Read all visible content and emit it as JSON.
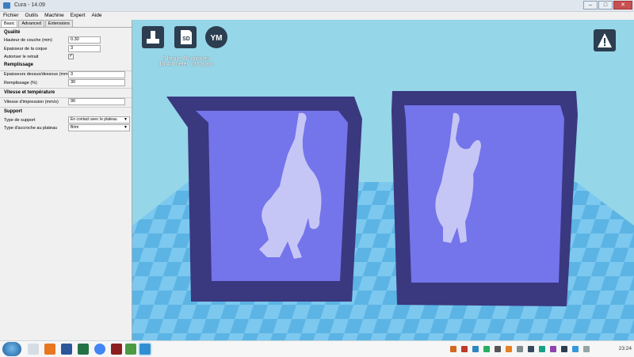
{
  "window": {
    "title": "Cura - 14.09",
    "buttons": {
      "minimize": "–",
      "maximize": "□",
      "close": "✕"
    }
  },
  "menu": [
    "Fichier",
    "Outils",
    "Machine",
    "Expert",
    "Aide"
  ],
  "tabs": [
    "Basic",
    "Advanced",
    "Extensions"
  ],
  "sections": {
    "quality": "Qualité",
    "fill": "Remplissage",
    "speed_temp": "Vitesse et température",
    "support": "Support"
  },
  "settings": {
    "layer_height": {
      "label": "Hauteur de couche (mm)",
      "value": "0.30"
    },
    "shell_thickness": {
      "label": "Epaisseur de la coque",
      "value": "3"
    },
    "retraction": {
      "label": "Autoriser le retrait",
      "value": "✓"
    },
    "bottom_top": {
      "label": "Epaisseurs dessus/dessous (mm)",
      "value": "3"
    },
    "fill_density": {
      "label": "Remplissage (%)",
      "value": "30"
    },
    "print_speed": {
      "label": "Vitesse d'impression (mm/s)",
      "value": "90"
    },
    "support_type": {
      "label": "Type de support",
      "value": "En contact avec le plateau"
    },
    "adhesion": {
      "label": "Type d'accroche au plateau",
      "value": "Brim"
    }
  },
  "toolbar": {
    "load_icon": "load-model-icon",
    "sd_label": "SD",
    "ym_label": "YM",
    "view_icon": "view-mode-icon"
  },
  "print_info": {
    "time": "5 heure 46 minutes",
    "material": "10.40 meter 130 gram"
  },
  "taskbar": {
    "clock": "23:24"
  },
  "colors": {
    "sky": "#8cd2e6",
    "floor_light": "#6fc1ea",
    "floor_dark": "#3f9bd3",
    "model_frame": "#3a387f",
    "model_face": "#7373eb",
    "cat": "#c8c8f5"
  }
}
